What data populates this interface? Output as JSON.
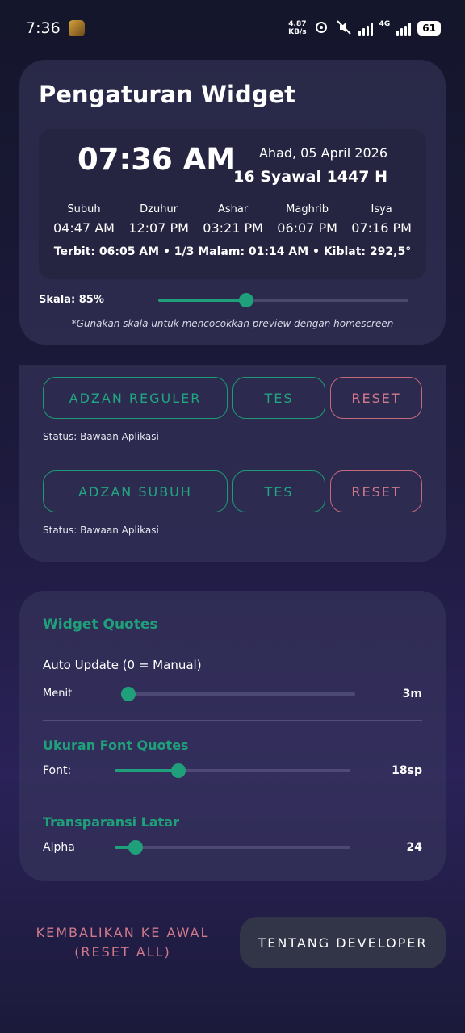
{
  "status_bar": {
    "time": "7:36",
    "speed_value": "4.87",
    "speed_unit": "KB/s",
    "network": "4G",
    "battery": "61"
  },
  "widget_settings": {
    "title": "Pengaturan Widget",
    "preview": {
      "time": "07:36 AM",
      "date": "Ahad, 05 April 2026",
      "hijri": "16 Syawal 1447 H",
      "prayers": [
        {
          "name": "Subuh",
          "time": "04:47 AM"
        },
        {
          "name": "Dzuhur",
          "time": "12:07 PM"
        },
        {
          "name": "Ashar",
          "time": "03:21 PM"
        },
        {
          "name": "Maghrib",
          "time": "06:07 PM"
        },
        {
          "name": "Isya",
          "time": "07:16 PM"
        }
      ],
      "info": "Terbit: 06:05 AM • 1/3 Malam: 01:14 AM • Kiblat: 292,5°"
    },
    "scale_label": "Skala: 85%",
    "scale_level": 0.35,
    "scale_hint": "*Gunakan skala untuk mencocokkan preview dengan homescreen"
  },
  "adzan": {
    "reguler_label": "ADZAN REGULER",
    "reguler_test": "TES",
    "reguler_reset": "RESET",
    "reguler_status": "Status: Bawaan Aplikasi",
    "subuh_label": "ADZAN SUBUH",
    "subuh_test": "TES",
    "subuh_reset": "RESET",
    "subuh_status": "Status: Bawaan Aplikasi"
  },
  "quotes": {
    "title": "Widget Quotes",
    "auto_update_label": "Auto Update (0 = Manual)",
    "menit_label": "Menit",
    "menit_value": "3m",
    "menit_level": 0.03,
    "font_title": "Ukuran Font Quotes",
    "font_label": "Font:",
    "font_value": "18sp",
    "font_level": 0.27,
    "alpha_title": "Transparansi Latar",
    "alpha_label": "Alpha",
    "alpha_value": "24",
    "alpha_level": 0.09
  },
  "footer": {
    "reset_all_line1": "KEMBALIKAN KE AWAL",
    "reset_all_line2": "(RESET ALL)",
    "developer_label": "TENTANG DEVELOPER"
  },
  "colors": {
    "accent": "#1fa07a",
    "danger": "#d07a8c",
    "card": "#3a385e"
  }
}
